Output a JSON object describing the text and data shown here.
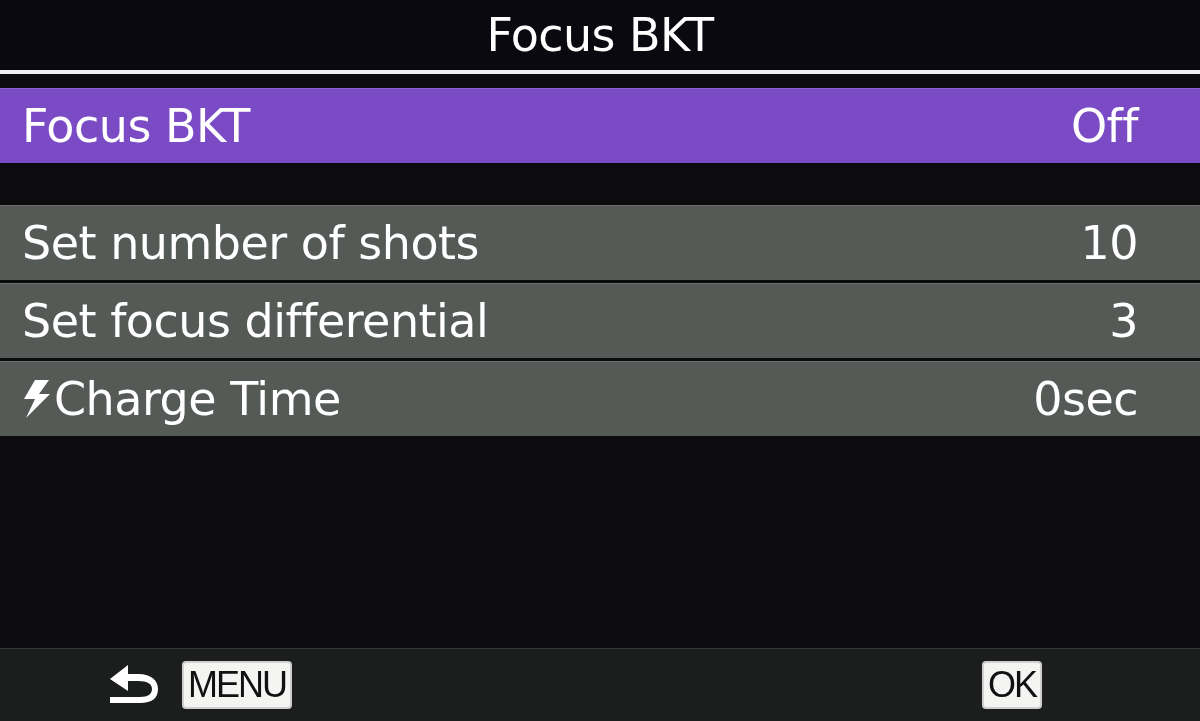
{
  "header": {
    "title": "Focus BKT"
  },
  "sections": [
    {
      "items": [
        {
          "label": "Focus BKT",
          "value": "Off",
          "kind": "plain",
          "selected": true
        }
      ]
    },
    {
      "items": [
        {
          "label": "Set number of shots",
          "value": "10",
          "kind": "plain",
          "selected": false
        },
        {
          "label": "Set focus differential",
          "value": "3",
          "kind": "plain",
          "selected": false
        },
        {
          "label": "Charge Time",
          "value": "0sec",
          "kind": "flash",
          "selected": false
        }
      ]
    }
  ],
  "footer": {
    "back_key": "MENU",
    "confirm_key": "OK"
  }
}
